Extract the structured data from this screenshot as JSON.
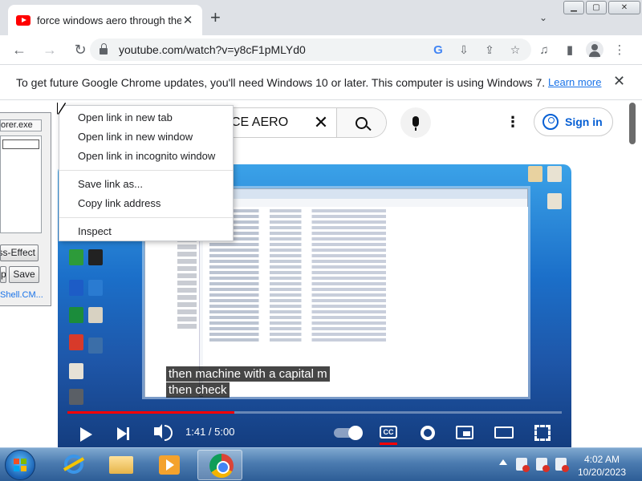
{
  "tab": {
    "title": "force windows aero through the",
    "close": "✕",
    "new_tab": "+",
    "search": "⌄"
  },
  "window": {
    "minimize": "▁",
    "maximize": "▢",
    "close": "✕"
  },
  "toolbar": {
    "back": "←",
    "forward": "→",
    "reload": "↻",
    "url": "youtube.com/watch?v=y8cF1pMLYd0",
    "g": "G",
    "install": "⇩",
    "share": "⇪",
    "star": "☆",
    "media": "♫",
    "sidepanel": "▮",
    "menu": "⋮"
  },
  "infobar": {
    "text": "To get future Google Chrome updates, you'll need Windows 10 or later. This computer is using Windows 7.",
    "link": "Learn more",
    "close": "✕"
  },
  "youtube": {
    "search_query": "CE AERO",
    "clear": "✕",
    "menu": "⋮",
    "sign_in": "Sign in"
  },
  "video": {
    "caption_lines": [
      "then machine with a capital m",
      "then check"
    ],
    "time": "1:41 / 5:00",
    "progress_fraction": 0.338,
    "cc_label": "CC"
  },
  "side_window": {
    "field": "orer.exe",
    "button1": "ass-Effect",
    "button2": "p",
    "button3": "Save",
    "link": "Shell.CM..."
  },
  "context_menu": {
    "group1": [
      "Open link in new tab",
      "Open link in new window",
      "Open link in incognito window"
    ],
    "group2": [
      "Save link as...",
      "Copy link address"
    ],
    "group3": [
      "Inspect"
    ]
  },
  "taskbar": {
    "time": "4:02 AM",
    "date": "10/20/2023"
  },
  "colors": {
    "youtube_red": "#ff0000",
    "link_blue": "#1a73e8",
    "signin_blue": "#065fd4",
    "taskbar": "#4b7bb0"
  }
}
